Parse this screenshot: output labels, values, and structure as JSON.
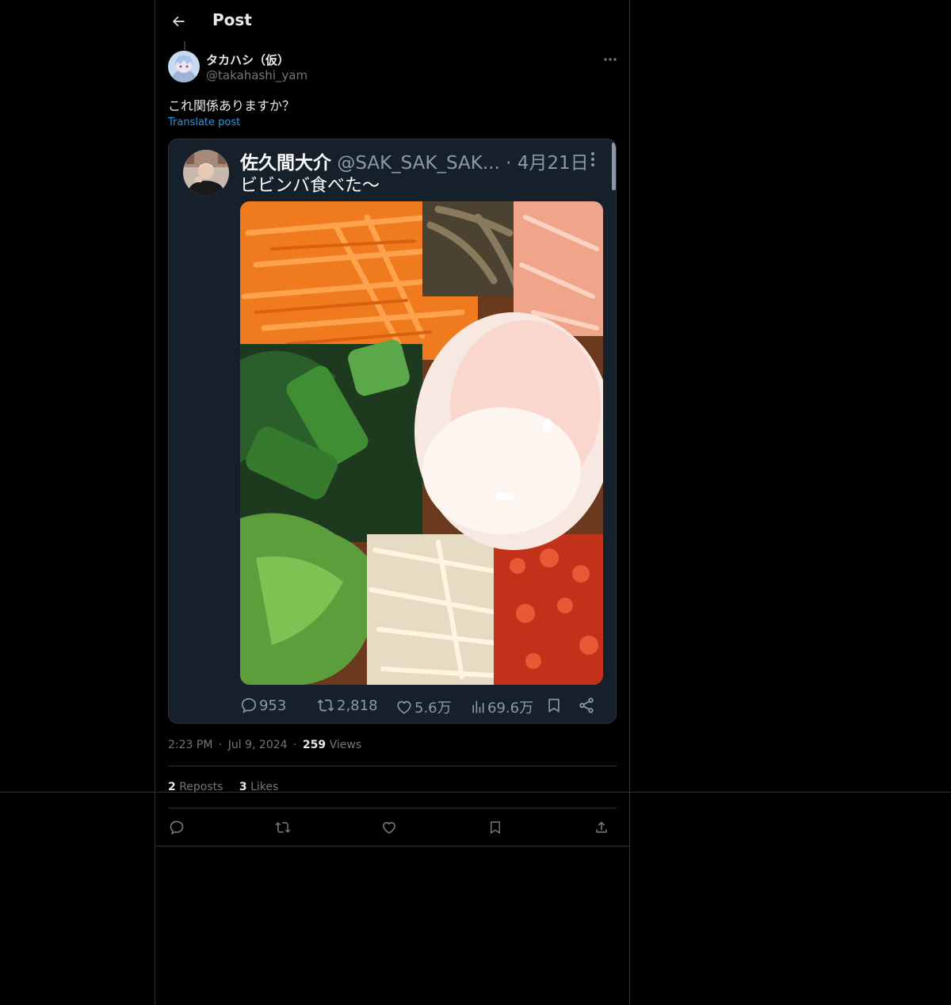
{
  "header": {
    "title": "Post",
    "back_icon": "arrow-left-icon"
  },
  "post": {
    "author": {
      "display_name": "タカハシ（仮）",
      "handle": "@takahashi_yam"
    },
    "text": "これ関係ありますか？",
    "translate_label": "Translate post",
    "embedded": {
      "display_name": "佐久間大介",
      "handle": "@SAK_SAK_SAK...",
      "separator": "·",
      "date": "4月21日",
      "text": "ビビンバ食べた〜",
      "photo_subject": "bibimbap",
      "counts": {
        "replies": "953",
        "reposts": "2,818",
        "likes": "5.6万",
        "views": "69.6万"
      }
    },
    "meta": {
      "time": "2:23 PM",
      "separator": "·",
      "date": "Jul 9, 2024",
      "views_count": "259",
      "views_label": "Views"
    },
    "stats": {
      "reposts_count": "2",
      "reposts_label": "Reposts",
      "likes_count": "3",
      "likes_label": "Likes"
    }
  },
  "colors": {
    "background": "#000000",
    "text": "#e7e9ea",
    "muted": "#71767b",
    "accent": "#1d9bf0",
    "border": "#2f3336",
    "embed_bg": "#15202b"
  }
}
